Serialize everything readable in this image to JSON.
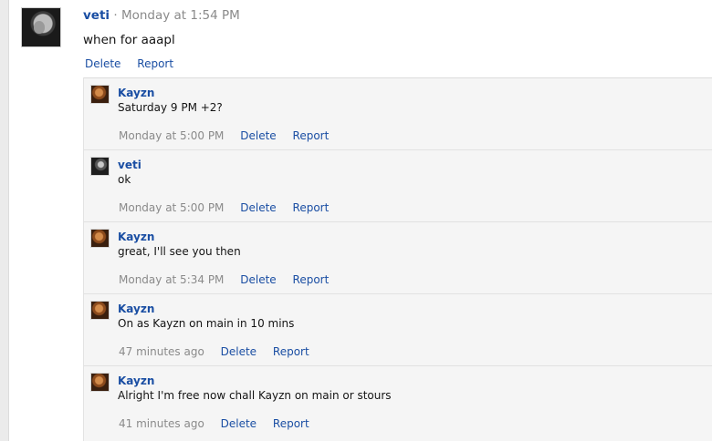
{
  "post": {
    "author": "veti",
    "separator": "·",
    "time": "Monday at 1:54 PM",
    "body": "when for aaapl",
    "actions": {
      "delete": "Delete",
      "report": "Report"
    }
  },
  "replies": [
    {
      "author": "Kayzn",
      "avatar": "kayzn-avatar",
      "text": "Saturday 9 PM +2?",
      "time": "Monday at 5:00 PM",
      "delete": "Delete",
      "report": "Report"
    },
    {
      "author": "veti",
      "avatar": "veti-avatar",
      "text": "ok",
      "time": "Monday at 5:00 PM",
      "delete": "Delete",
      "report": "Report"
    },
    {
      "author": "Kayzn",
      "avatar": "kayzn-avatar",
      "text": "great, I'll see you then",
      "time": "Monday at 5:34 PM",
      "delete": "Delete",
      "report": "Report"
    },
    {
      "author": "Kayzn",
      "avatar": "kayzn-avatar",
      "text": "On as Kayzn on main in 10 mins",
      "time": "47 minutes ago",
      "delete": "Delete",
      "report": "Report"
    },
    {
      "author": "Kayzn",
      "avatar": "kayzn-avatar",
      "text": "Alright I'm free now chall Kayzn on main or stours",
      "time": "41 minutes ago",
      "delete": "Delete",
      "report": "Report"
    }
  ],
  "colors": {
    "link": "#1a4ea3",
    "muted": "#8a8a8a",
    "reply_background": "#f5f5f5"
  }
}
